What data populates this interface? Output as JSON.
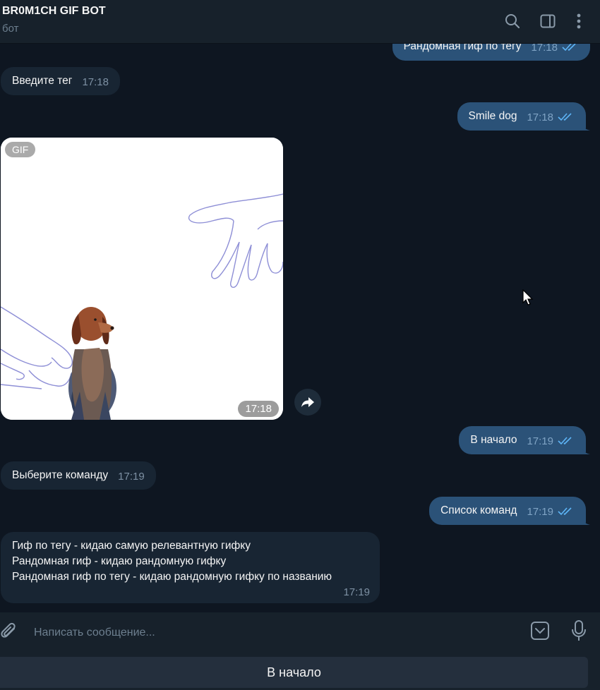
{
  "header": {
    "title": "BR0M1CH GIF BOT",
    "status": "бот"
  },
  "messages": [
    {
      "side": "out",
      "text": "Рандомная гиф по тегу",
      "time": "17:18"
    },
    {
      "side": "in",
      "text": "Введите тег",
      "time": "17:18"
    },
    {
      "side": "out",
      "text": "Smile dog",
      "time": "17:18"
    },
    {
      "side": "in",
      "type": "gif",
      "badge": "GIF",
      "time": "17:18"
    },
    {
      "side": "out",
      "text": "В начало",
      "time": "17:19"
    },
    {
      "side": "in",
      "text": "Выберите команду",
      "time": "17:19"
    },
    {
      "side": "out",
      "text": "Список команд",
      "time": "17:19"
    },
    {
      "side": "in",
      "lines": [
        "Гиф по тегу - кидаю самую релевантную гифку",
        "Рандомная гиф - кидаю рандомную гифку",
        "Рандомная гиф по тегу - кидаю рандомную гифку по названию"
      ],
      "time": "17:19"
    }
  ],
  "composer": {
    "placeholder": "Написать сообщение..."
  },
  "keyboard": {
    "button_label": "В начало"
  },
  "colors": {
    "background": "#0e1621",
    "header": "#17212b",
    "incoming_bubble": "#182533",
    "outgoing_bubble": "#2b5278",
    "check_marks": "#5eb5f7"
  },
  "icons": [
    "search-icon",
    "sidebar-toggle-icon",
    "more-vertical-icon",
    "forward-icon",
    "paperclip-icon",
    "emoji-keyboard-icon",
    "microphone-icon",
    "double-check-icon"
  ]
}
